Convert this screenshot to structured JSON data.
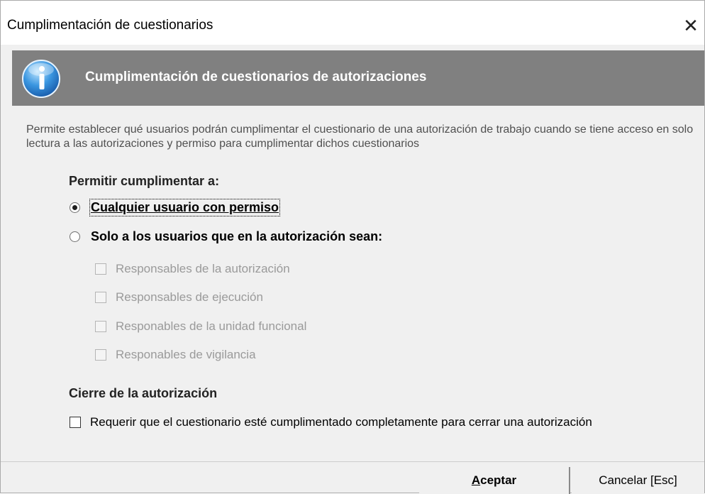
{
  "window": {
    "title": "Cumplimentación de cuestionarios",
    "close_glyph": "✕"
  },
  "banner": {
    "icon": "info-icon",
    "title": "Cumplimentación de cuestionarios de autorizaciones",
    "background": "#808080"
  },
  "description": "Permite establecer qué usuarios podrán cumplimentar el cuestionario de una autorización de trabajo cuando se tiene acceso en solo lectura a las autorizaciones y permiso para cumplimentar dichos cuestionarios",
  "permit": {
    "label": "Permitir cumplimentar a:",
    "options": [
      {
        "label": "Cualquier usuario con permiso",
        "selected": true
      },
      {
        "label": "Solo a los usuarios que en la autorización sean:",
        "selected": false
      }
    ],
    "roles": [
      {
        "label": "Responsables de la autorización",
        "checked": false,
        "enabled": false
      },
      {
        "label": "Responsables de ejecución",
        "checked": false,
        "enabled": false
      },
      {
        "label": "Responables de la unidad funcional",
        "checked": false,
        "enabled": false
      },
      {
        "label": "Responables de vigilancia",
        "checked": false,
        "enabled": false
      }
    ]
  },
  "closure": {
    "label": "Cierre de la autorización",
    "require_label": "Requerir que el cuestionario esté cumplimentado completamente para cerrar una autorización",
    "require_checked": false
  },
  "buttons": {
    "accept_accel": "A",
    "accept_rest": "ceptar",
    "cancel": "Cancelar [Esc]"
  }
}
